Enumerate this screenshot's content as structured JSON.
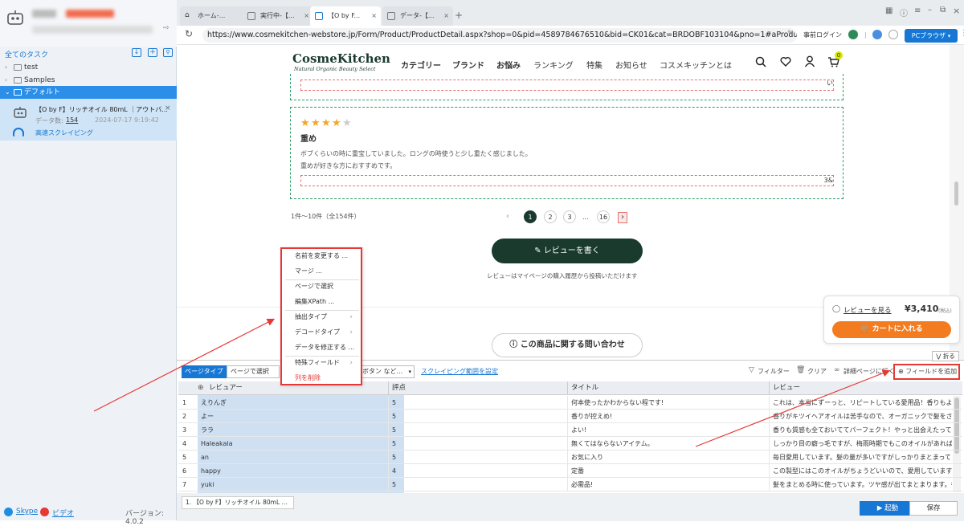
{
  "sidebar": {
    "all_tasks": "全てのタスク",
    "folders": [
      {
        "label": "test"
      },
      {
        "label": "Samples"
      },
      {
        "label": "デフォルト"
      }
    ],
    "task": {
      "title": "【O by F】リッチオイル 80mL ｜アウトバ...",
      "data_count_label": "データ数:",
      "data_count": "154",
      "timestamp": "2024-07-17 9:19:42",
      "mode": "高速スクレイピング"
    },
    "footer": {
      "skype": "Skype",
      "video": "ビデオ",
      "version": "バージョン: 4.0.2"
    }
  },
  "tabs": [
    {
      "label": "ホーム-..."
    },
    {
      "label": "実行中-【..."
    },
    {
      "label": "【O by F..."
    },
    {
      "label": "データ-【..."
    }
  ],
  "address": {
    "url": "https://www.cosmekitchen-webstore.jp/Form/Product/ProductDetail.aspx?shop=0&pid=4589784676510&bid=CK01&cat=BRDOBF103104&pno=1#aProductReview",
    "login": "事前ログイン",
    "pc_browser": "PCブラウザ"
  },
  "site": {
    "brand": "CosmeKitchen",
    "brand_sub": "Natural Organic Beauty Select",
    "nav": [
      "カテゴリー",
      "ブランド",
      "お悩み",
      "ランキング",
      "特集",
      "お知らせ",
      "コスメキッチンとは"
    ],
    "cart_badge": "0",
    "prev_review_tail": "い",
    "review": {
      "rating": 4,
      "title": "重め",
      "body1": "ボブくらいの時に重宝していました。ロングの時使うと少し重たく感じました。",
      "body2": "重めが好きな方におすすめです。",
      "tail": "3&"
    },
    "pager_summary": "1件～10件（全154件）",
    "pages": [
      "1",
      "2",
      "3",
      "...",
      "16"
    ],
    "write_review": "レビューを書く",
    "write_note": "レビューはマイページの購入履歴から投稿いただけます",
    "inquiry": "この商品に関する問い合わせ",
    "float": {
      "see_reviews": "レビューを見る",
      "price": "¥3,410",
      "tax": "(税込)",
      "add_cart": "カートに入れる"
    }
  },
  "context_menu": [
    "名前を変更する ...",
    "マージ ...",
    "ページで選択",
    "編集XPath ...",
    "抽出タイプ",
    "デコードタイプ",
    "データを修正する ...",
    "特殊フィールド",
    "列を削除"
  ],
  "panel": {
    "collapse": "折る",
    "page_type": "ページタイプ",
    "select_by_page": "ページで選択",
    "button_label": "ボタン など...",
    "scrape_range": "スクレイピング範囲を設定",
    "filter": "フィルター",
    "clear": "クリア",
    "detail_page": "詳細ページに行く",
    "add_field": "フィールドを追加",
    "columns": [
      "レビュアー",
      "評点",
      "タイトル",
      "レビュー"
    ],
    "rows": [
      [
        "1",
        "えりんぎ",
        "5",
        "何本使ったかわからない程です!",
        "これは、本当にずーっと、リピートしている愛用品！香りもよ..."
      ],
      [
        "2",
        "よー",
        "5",
        "香りが控えめ!",
        "香りがキツイヘアオイルは苦手なので、オーガニックで髪をさら..."
      ],
      [
        "3",
        "ララ",
        "5",
        "よい!",
        "香りも質感も全ておいててパーフェクト！やっと出会えたって感..."
      ],
      [
        "4",
        "Haleakala",
        "5",
        "無くてはならないアイテム。",
        "しっかり目の癖っ毛ですが、梅雨時期でもこのオイルがあれば髪..."
      ],
      [
        "5",
        "an",
        "5",
        "お気に入り",
        "毎日愛用しています。髪の量が多いですがしっかりまとまってく..."
      ],
      [
        "6",
        "happy",
        "4",
        "定番",
        "この製型にはこのオイルがちょうどいいので、愛用しています!"
      ],
      [
        "7",
        "yuki",
        "5",
        "必需品!",
        "髪をまとめる時に使っています。ツヤ感が出てまとまります。香..."
      ]
    ],
    "task_tab": "1. 【O by F】リッチオイル 80mL ...",
    "start": "起動",
    "save": "保存"
  }
}
